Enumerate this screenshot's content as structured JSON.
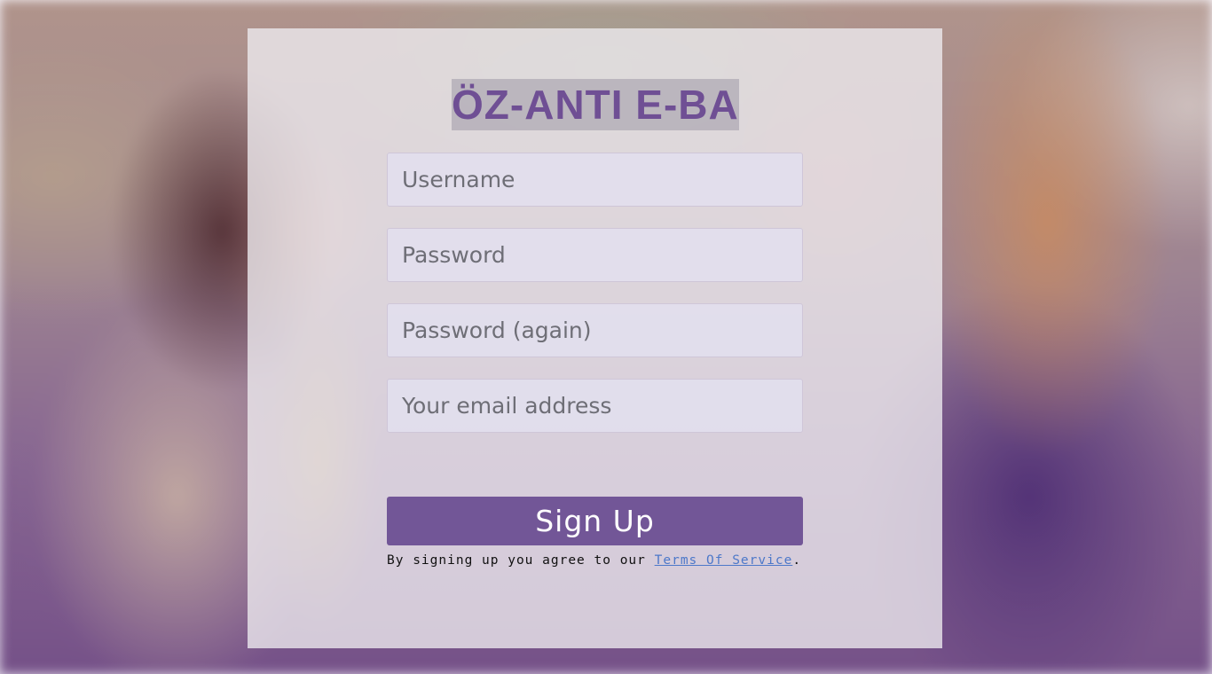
{
  "brand": {
    "logo_text": "ÖZ-ANTI E-BANK",
    "accent_color": "#725697"
  },
  "form": {
    "username_placeholder": "Username",
    "password_placeholder": "Password",
    "password_again_placeholder": "Password (again)",
    "email_placeholder": "Your email address",
    "username_value": "",
    "password_value": "",
    "password_again_value": "",
    "email_value": "",
    "submit_label": "Sign Up"
  },
  "terms": {
    "prefix": "By signing up you agree to our ",
    "link_label": "Terms Of Service",
    "suffix": "."
  }
}
